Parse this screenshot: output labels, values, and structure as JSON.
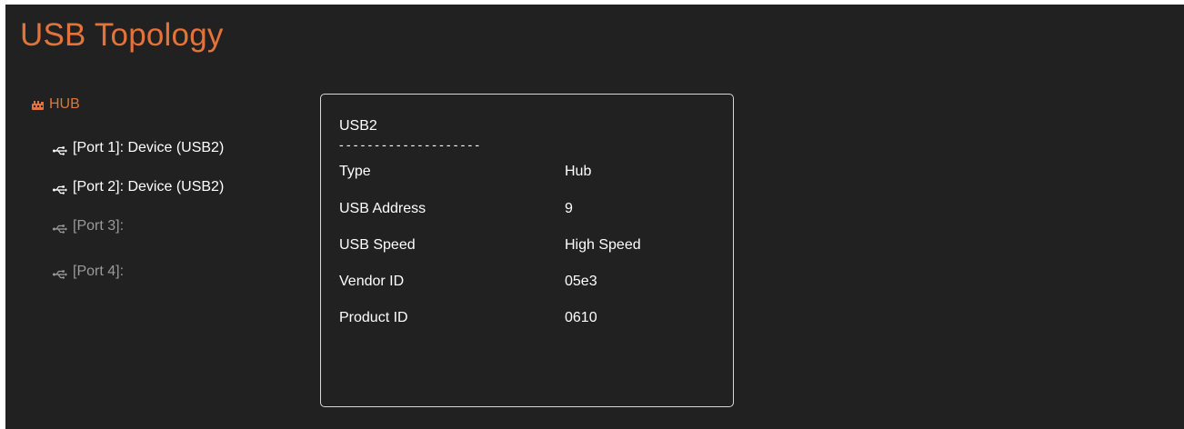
{
  "header": {
    "title": "USB Topology"
  },
  "colors": {
    "accent": "#e3733a",
    "background": "#212121",
    "text": "#ffffff",
    "dim_text": "#9a9a9a",
    "panel_border": "#d8d8d8"
  },
  "tree": {
    "root": {
      "icon": "hub-icon",
      "label": "HUB"
    },
    "items": [
      {
        "icon": "usb-icon",
        "label": "[Port 1]: Device (USB2)",
        "enabled": true
      },
      {
        "icon": "usb-icon",
        "label": "[Port 2]: Device (USB2)",
        "enabled": true
      },
      {
        "icon": "usb-icon",
        "label": "[Port 3]:",
        "enabled": false
      },
      {
        "icon": "usb-icon",
        "label": "[Port 4]:",
        "enabled": false
      }
    ]
  },
  "details": {
    "title": "USB2",
    "separator": "--------------------",
    "rows": [
      {
        "key": "Type",
        "value": "Hub"
      },
      {
        "key": "USB Address",
        "value": "9"
      },
      {
        "key": "USB Speed",
        "value": "High Speed"
      },
      {
        "key": "Vendor ID",
        "value": "05e3"
      },
      {
        "key": "Product ID",
        "value": "0610"
      }
    ]
  }
}
